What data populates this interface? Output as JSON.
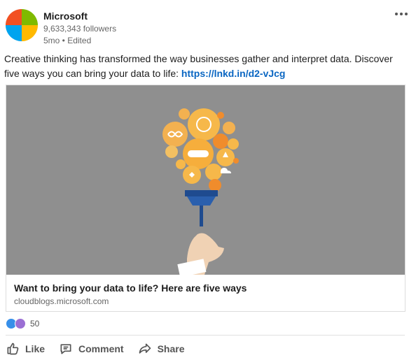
{
  "post": {
    "author": "Microsoft",
    "followers": "9,633,343 followers",
    "meta": "5mo • Edited",
    "text": "Creative thinking has transformed the way businesses gather and interpret data. Discover five ways you can bring your data to life:",
    "link": "https://lnkd.in/d2-vJcg"
  },
  "card": {
    "title": "Want to bring your data to life? Here are five ways",
    "domain": "cloudblogs.microsoft.com"
  },
  "reactions": {
    "count": "50",
    "types": [
      "like-icon",
      "love-icon"
    ]
  },
  "actions": {
    "like": "Like",
    "comment": "Comment",
    "share": "Share"
  },
  "colors": {
    "ms_red": "#f25022",
    "ms_green": "#7fba00",
    "ms_blue": "#00a4ef",
    "ms_yellow": "#ffb900",
    "link": "#0a66c2",
    "card_bg": "#8f8f8f"
  }
}
